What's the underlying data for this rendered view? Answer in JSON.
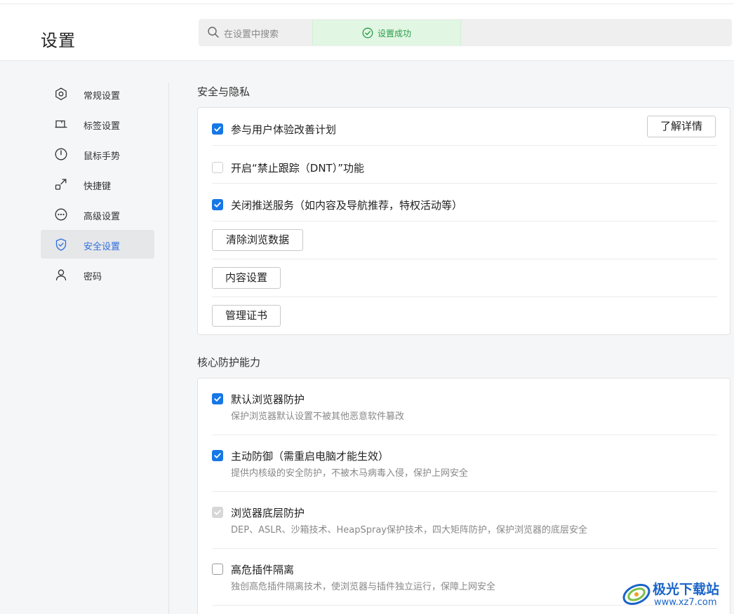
{
  "header": {
    "title": "设置",
    "search_placeholder": "在设置中搜索",
    "toast_text": "设置成功"
  },
  "sidebar": {
    "items": [
      {
        "label": "常规设置",
        "icon": "hexagon-gear-icon"
      },
      {
        "label": "标签设置",
        "icon": "tab-icon"
      },
      {
        "label": "鼠标手势",
        "icon": "mouse-icon"
      },
      {
        "label": "快捷键",
        "icon": "shortcut-arrow-icon"
      },
      {
        "label": "高级设置",
        "icon": "more-dots-icon"
      },
      {
        "label": "安全设置",
        "icon": "shield-icon",
        "active": true
      },
      {
        "label": "密码",
        "icon": "user-icon"
      }
    ]
  },
  "security_privacy": {
    "title": "安全与隐私",
    "items": [
      {
        "label": "参与用户体验改善计划",
        "checked": true,
        "button": "了解详情"
      },
      {
        "label": "开启“禁止跟踪（DNT）”功能",
        "checked": false
      },
      {
        "label": "关闭推送服务（如内容及导航推荐，特权活动等）",
        "checked": true
      }
    ],
    "buttons": [
      "清除浏览数据",
      "内容设置",
      "管理证书"
    ]
  },
  "core_protection": {
    "title": "核心防护能力",
    "items": [
      {
        "label": "默认浏览器防护",
        "desc": "保护浏览器默认设置不被其他恶意软件篡改",
        "checked": true
      },
      {
        "label": "主动防御（需重启电脑才能生效）",
        "desc": "提供内核级的安全防护，不被木马病毒入侵，保护上网安全",
        "checked": true
      },
      {
        "label": "浏览器底层防护",
        "desc": "DEP、ASLR、沙箱技术、HeapSpray保护技术，四大矩阵防护，保护浏览器的底层安全",
        "checked": true,
        "disabled": true
      },
      {
        "label": "高危插件隔离",
        "desc": "独创高危插件隔离技术，使浏览器与插件独立运行，保障上网安全",
        "checked": false
      }
    ]
  },
  "watermark": {
    "title": "极光下载站",
    "url": "www.xz7.com"
  },
  "colors": {
    "accent": "#1677e6",
    "active_nav_text": "#2f6fe0",
    "toast_bg": "#e1f6e3",
    "toast_text": "#2a9d4a"
  }
}
